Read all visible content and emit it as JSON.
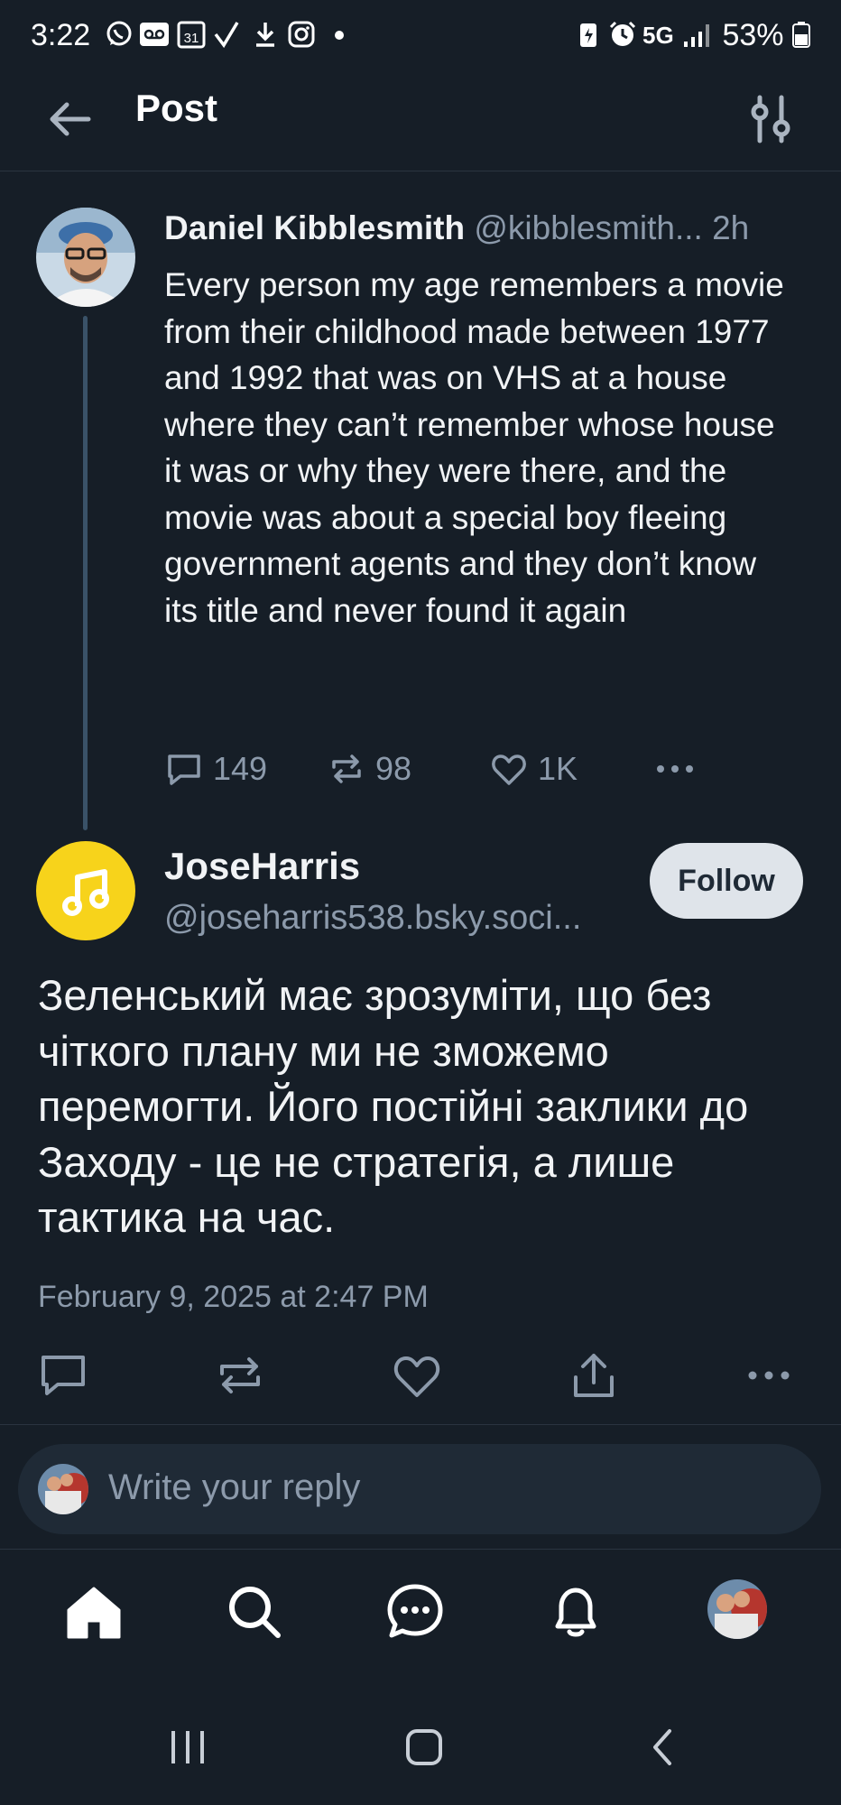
{
  "status_bar": {
    "time": "3:22",
    "network": "5G",
    "battery": "53%"
  },
  "header": {
    "title": "Post"
  },
  "parent_post": {
    "author_name": "Daniel Kibblesmith",
    "author_handle": "@kibblesmith...",
    "time_ago": "2h",
    "text": "Every person my age remembers a movie from their childhood made between 1977 and 1992 that was on VHS at a house where they can’t remember whose house it was or why they were there, and the movie was about a special boy fleeing government agents and they don’t know its title and never found it again",
    "reply_count": "149",
    "repost_count": "98",
    "like_count": "1K"
  },
  "main_post": {
    "author_name": "JoseHarris",
    "author_handle": "@joseharris538.bsky.soci...",
    "follow_label": "Follow",
    "text": "Зеленський має зрозуміти, що без чіткого плану ми не зможемо перемогти. Його постійні заклики до Заходу - це не стратегія, а лише тактика на час.",
    "date": "February 9, 2025 at 2:47 PM"
  },
  "reply": {
    "placeholder": "Write your reply"
  },
  "colors": {
    "background": "#161e27",
    "muted_text": "#8c9aab",
    "thread_line": "#3a5268",
    "avatar_yellow": "#f7d31b"
  }
}
